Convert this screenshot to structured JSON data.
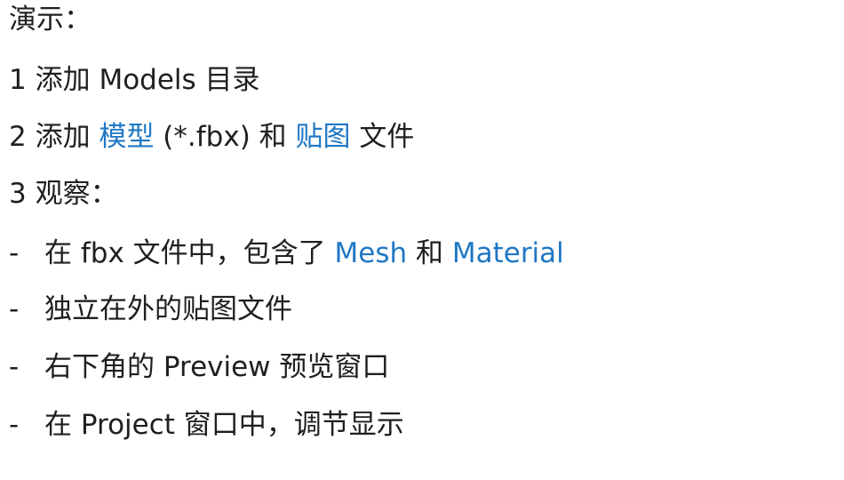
{
  "heading": "演示：",
  "steps": [
    {
      "num": "1",
      "text": "添加 Models 目录"
    },
    {
      "num": "2",
      "pre": "添加 ",
      "accent1": "模型",
      "mid": " (*.fbx)  和 ",
      "accent2": "贴图",
      "post": " 文件"
    },
    {
      "num": "3",
      "text": "观察："
    }
  ],
  "bullets": [
    {
      "dash": "-",
      "pre": "在 fbx 文件中，包含了 ",
      "accent1": "Mesh",
      "mid": " 和 ",
      "accent2": "Material"
    },
    {
      "dash": "-",
      "text": "独立在外的贴图文件"
    },
    {
      "dash": "-",
      "text": "右下角的 Preview 预览窗口"
    },
    {
      "dash": "-",
      "text": "在 Project 窗口中，调节显示"
    }
  ],
  "colors": {
    "text": "#1f1f1f",
    "accent": "#1f77c4",
    "background": "#ffffff"
  }
}
